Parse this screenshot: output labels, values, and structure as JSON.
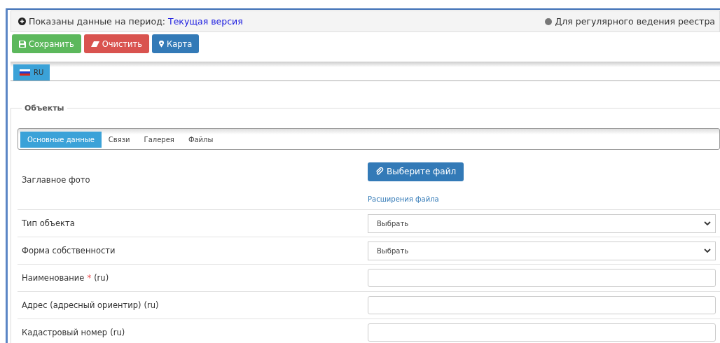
{
  "info_bar": {
    "period_label": "Показаны данные на период:",
    "period_value": "Текущая версия",
    "mode": "Для регулярного ведения реестра"
  },
  "toolbar": [
    {
      "kind": "save",
      "label": "Сохранить"
    },
    {
      "kind": "clear",
      "label": "Очистить"
    },
    {
      "kind": "map",
      "label": "Карта"
    }
  ],
  "language_tabs": [
    {
      "label": "RU",
      "selected": true
    }
  ],
  "section": {
    "legend": "Объекты",
    "tabs": [
      {
        "label": "Основные данные",
        "selected": true
      },
      {
        "label": "Связи",
        "selected": false
      },
      {
        "label": "Галерея",
        "selected": false
      },
      {
        "label": "Файлы",
        "selected": false
      }
    ],
    "fields": [
      {
        "kind": "file",
        "label": "Заглавное фото",
        "button": "Выберите файл",
        "link": "Расширения файла"
      },
      {
        "kind": "select",
        "label": "Тип объекта",
        "value": "Выбрать"
      },
      {
        "kind": "select",
        "label": "Форма собственности",
        "value": "Выбрать"
      },
      {
        "kind": "text",
        "label": "Наименование",
        "required_mark": "*",
        "suffix": "(ru)"
      },
      {
        "kind": "text",
        "label": "Адрес (адресный ориентир)",
        "suffix": "(ru)"
      },
      {
        "kind": "text",
        "label": "Кадастровый номер",
        "suffix": "(ru)"
      }
    ]
  }
}
